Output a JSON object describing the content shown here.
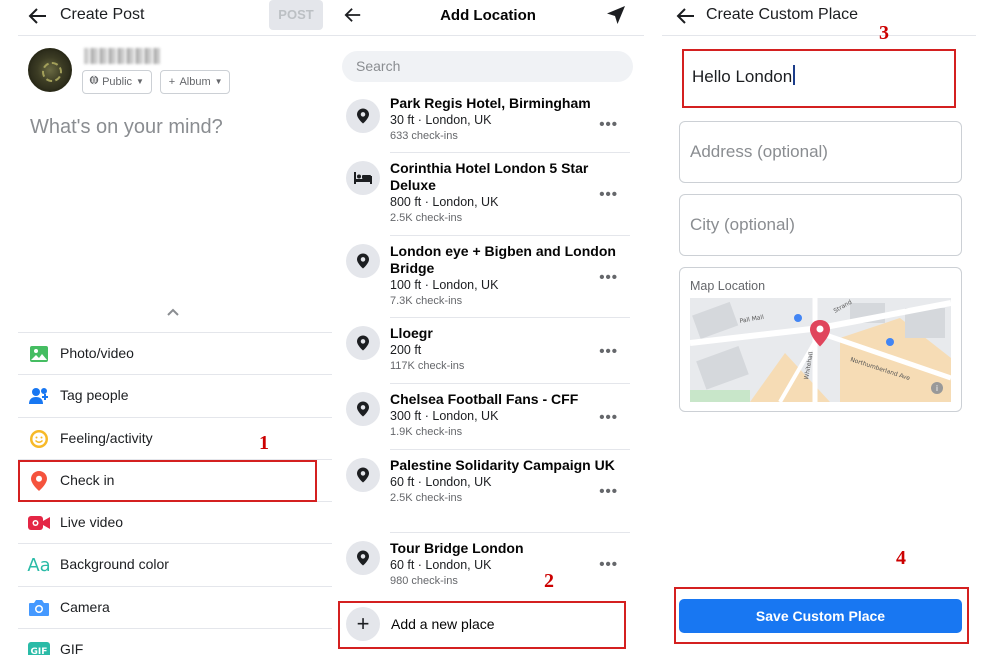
{
  "panel1": {
    "title": "Create Post",
    "post_label": "POST",
    "privacy_label": "Public",
    "album_label": "Album",
    "composer_placeholder": "What's on your mind?",
    "options": [
      {
        "label": "Photo/video",
        "icon": "photo-icon",
        "color": "#45bd62"
      },
      {
        "label": "Tag people",
        "icon": "tag-people-icon",
        "color": "#1877f2"
      },
      {
        "label": "Feeling/activity",
        "icon": "smiley-icon",
        "color": "#f7b928"
      },
      {
        "label": "Check in",
        "icon": "location-pin-icon",
        "color": "#f5533d"
      },
      {
        "label": "Live video",
        "icon": "live-video-icon",
        "color": "#e42645"
      },
      {
        "label": "Background color",
        "icon": "text-aa-icon",
        "color": "#2abba7"
      },
      {
        "label": "Camera",
        "icon": "camera-icon",
        "color": "#4599ff"
      },
      {
        "label": "GIF",
        "icon": "gif-icon",
        "color": "#2abba7"
      }
    ],
    "annotation": "1"
  },
  "panel2": {
    "title": "Add Location",
    "search_placeholder": "Search",
    "places": [
      {
        "name": "Park Regis Hotel, Birmingham",
        "meta": "30 ft · London, UK",
        "checkins": "633 check-ins",
        "icon": "location-pin-icon"
      },
      {
        "name": "Corinthia Hotel London 5 Star Deluxe",
        "meta": "800 ft · London, UK",
        "checkins": "2.5K check-ins",
        "icon": "bed-icon"
      },
      {
        "name": "London eye + Bigben and London Bridge",
        "meta": "100 ft · London, UK",
        "checkins": "7.3K check-ins",
        "icon": "location-pin-icon"
      },
      {
        "name": "Lloegr",
        "meta": "200 ft",
        "checkins": "117K check-ins",
        "icon": "location-pin-icon"
      },
      {
        "name": "Chelsea Football Fans - CFF",
        "meta": "300 ft · London, UK",
        "checkins": "1.9K check-ins",
        "icon": "location-pin-icon"
      },
      {
        "name": "Palestine Solidarity Campaign UK",
        "meta": "60 ft · London, UK",
        "checkins": "2.5K check-ins",
        "icon": "location-pin-icon"
      },
      {
        "name": "Tour Bridge London",
        "meta": "60 ft · London, UK",
        "checkins": "980 check-ins",
        "icon": "location-pin-icon"
      }
    ],
    "more_label": "•••",
    "add_place_label": "Add a new place",
    "annotation": "2"
  },
  "panel3": {
    "title": "Create Custom Place",
    "name_value": "Hello London",
    "address_placeholder": "Address (optional)",
    "city_placeholder": "City (optional)",
    "map_label": "Map Location",
    "map_streets": {
      "pall_mall": "Pall Mall",
      "strand": "Strand",
      "northumberland": "Northumberland Ave",
      "whitehall": "Whitehall"
    },
    "save_label": "Save Custom Place",
    "annotation_name": "3",
    "annotation_save": "4"
  },
  "colors": {
    "accent": "#1877f2",
    "annotation": "#d42020",
    "pin": "#e0455c"
  }
}
